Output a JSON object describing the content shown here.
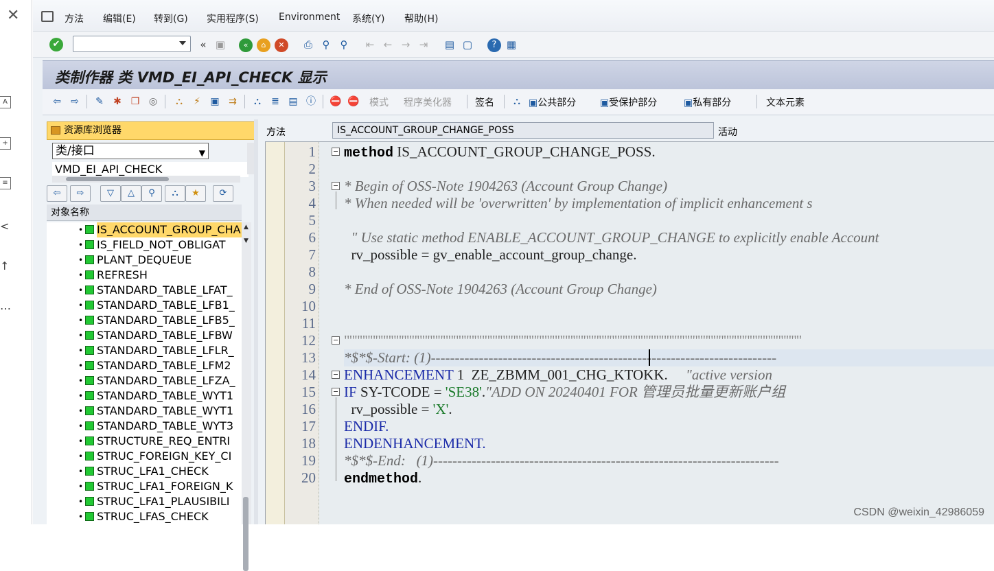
{
  "menubar": {
    "items": [
      "方法",
      "编辑(E)",
      "转到(G)",
      "实用程序(S)",
      "Environment",
      "系统(Y)",
      "帮助(H)"
    ]
  },
  "toolbar": {
    "back_label": "«"
  },
  "title": "类制作器 类 VMD_EI_API_CHECK 显示",
  "app_toolbar": {
    "mode": "模式",
    "pretty_printer": "程序美化器",
    "signature": "签名",
    "public_section": "公共部分",
    "protected_section": "受保护部分",
    "private_section": "私有部分",
    "text_elements": "文本元素"
  },
  "repository": {
    "title": "资源库浏览器",
    "object_type": "类/接口",
    "object_name": "VMD_EI_API_CHECK",
    "column_header": "对象名称",
    "items": [
      "IS_ACCOUNT_GROUP_CHANGE_POSS",
      "IS_FIELD_NOT_OBLIGAT",
      "PLANT_DEQUEUE",
      "REFRESH",
      "STANDARD_TABLE_LFAT_",
      "STANDARD_TABLE_LFB1_",
      "STANDARD_TABLE_LFB5_",
      "STANDARD_TABLE_LFBW",
      "STANDARD_TABLE_LFLR_",
      "STANDARD_TABLE_LFM2",
      "STANDARD_TABLE_LFZA_",
      "STANDARD_TABLE_WYT1",
      "STANDARD_TABLE_WYT1",
      "STANDARD_TABLE_WYT3",
      "STRUCTURE_REQ_ENTRI",
      "STRUC_FOREIGN_KEY_CI",
      "STRUC_LFA1_CHECK",
      "STRUC_LFA1_FOREIGN_K",
      "STRUC_LFA1_PLAUSIBILI",
      "STRUC_LFAS_CHECK"
    ]
  },
  "method_field": {
    "label": "方法",
    "value": "IS_ACCOUNT_GROUP_CHANGE_POSS",
    "status": "活动"
  },
  "code": {
    "line_numbers": [
      "1",
      "2",
      "3",
      "4",
      "5",
      "6",
      "7",
      "8",
      "9",
      "10",
      "11",
      "12",
      "13",
      "14",
      "15",
      "16",
      "17",
      "18",
      "19",
      "20"
    ],
    "l1_kw": "method",
    "l1_rest": " IS_ACCOUNT_GROUP_CHANGE_POSS.",
    "l3": "* Begin of OSS-Note 1904263 (Account Group Change)",
    "l4": "* When needed will be 'overwritten' by implementation of implicit enhancement s",
    "l6": "  \" Use static method ENABLE_ACCOUNT_GROUP_CHANGE to explicitly enable Account",
    "l7": "  rv_possible = gv_enable_account_group_change.",
    "l9": "* End of OSS-Note 1904263 (Account Group Change)",
    "l12": "\"\"\"\"\"\"\"\"\"\"\"\"\"\"\"\"\"\"\"\"\"\"\"\"\"\"\"\"\"\"\"\"\"\"\"\"\"\"\"\"\"\"\"\"\"\"\"\"\"\"\"\"\"\"\"\"\"\"\"\"\"\"\"\"\"\"\"\"\"\"\"\"\"\"\"\"\"\"\"\"\"\"\"\"\"\"\"\"",
    "l13": "*$*$-Start: (1)------------------------------------------------------------------------",
    "l14_kw": "ENHANCEMENT",
    "l14_rest": " 1  ZE_ZBMM_001_CHG_KTOKK.     ",
    "l14_cm": "\"active version",
    "l15_kw": "IF",
    "l15_mid": " SY-TCODE = ",
    "l15_str": "'SE38'",
    "l15_dot": ".",
    "l15_cm": "\"ADD ON 20240401 FOR 管理员批量更新账户组",
    "l16_pre": "  rv_possible = ",
    "l16_str": "'X'",
    "l16_dot": ".",
    "l17": "ENDIF.",
    "l18": "ENDENHANCEMENT.",
    "l19": "*$*$-End:   (1)------------------------------------------------------------------------",
    "l20_kw": "endmethod",
    "l20_dot": "."
  },
  "watermark": "CSDN @weixin_42986059",
  "colors": {
    "title_bg": "#c5cce0",
    "repo_highlight": "#ffd86a",
    "keyword_blue": "#1a2aa8",
    "string_green": "#1a7a2a"
  }
}
